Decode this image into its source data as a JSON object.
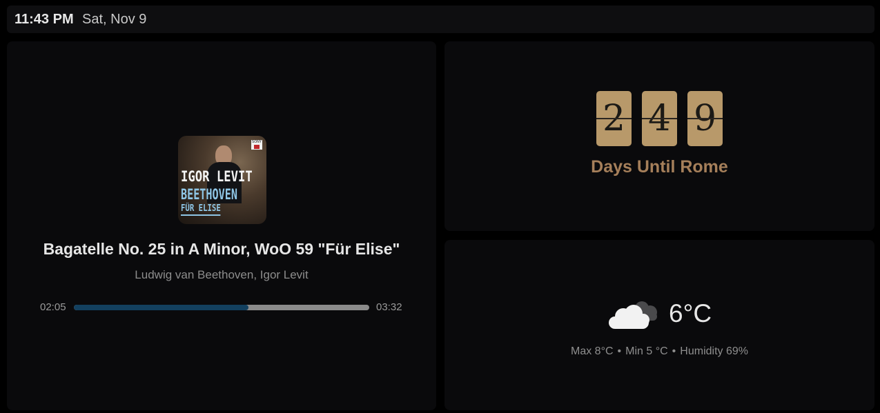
{
  "status_bar": {
    "time": "11:43 PM",
    "date": "Sat, Nov 9"
  },
  "media": {
    "album_art": {
      "artist_first": "IGOR",
      "artist_last": "LEVIT",
      "composer": "BEETHOVEN",
      "subtitle": "FÜR ELISE",
      "label": "SONY"
    },
    "title": "Bagatelle No. 25 in A Minor, WoO 59 \"Für Elise\"",
    "artist": "Ludwig van Beethoven, Igor Levit",
    "position": "02:05",
    "duration": "03:32",
    "progress_fraction": 0.59,
    "progress_color": "#13405f"
  },
  "countdown": {
    "digits": [
      "2",
      "4",
      "9"
    ],
    "label": "Days Until Rome",
    "digit_color": "#b8996a",
    "label_color": "#a57f5a"
  },
  "weather": {
    "icon": "cloudy-icon",
    "temperature": "6°C",
    "max": "Max 8°C",
    "min": "Min 5 °C",
    "humidity": "Humidity 69%",
    "separator": "•"
  }
}
